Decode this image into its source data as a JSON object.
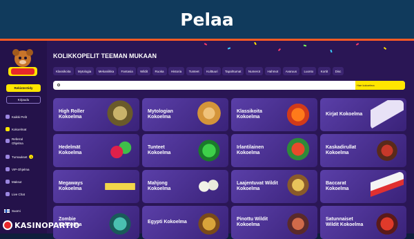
{
  "banner": {
    "title": "Pelaa"
  },
  "sidebar": {
    "register_label": "Rekisteröidy",
    "login_label": "Kirjaudu",
    "nav": [
      {
        "label": "Kaikki Pelit",
        "icon": "grid-icon"
      },
      {
        "label": "Kokoelmat",
        "icon": "collection-icon"
      },
      {
        "label": "Referral Ohjelma",
        "icon": "gift-icon"
      },
      {
        "label": "Turnaukset",
        "icon": "trophy-icon",
        "badge": "1"
      },
      {
        "label": "VIP-Ohjelma",
        "icon": "crown-icon"
      },
      {
        "label": "Maksut",
        "icon": "wallet-icon"
      },
      {
        "label": "Live Chat",
        "icon": "chat-icon"
      }
    ],
    "language": "Suomi"
  },
  "main": {
    "section_title": "KOLIKKOPELIT TEEMAN MUKAAN",
    "themes": [
      "Klassikoita",
      "Mytologia",
      "Mekaniikka",
      "Fantasia",
      "Wildit",
      "Ruoka",
      "Historia",
      "Tunteet",
      "Kulttuuri",
      "Tapahtumat",
      "Numerot",
      "Hahmot",
      "Avaruus",
      "Luonto",
      "Kortit",
      "Disc"
    ],
    "search": {
      "placeholder": "",
      "button": "Hae kokoelma"
    },
    "cards": [
      {
        "label": "High Roller Kokoelma",
        "art": "vault-art"
      },
      {
        "label": "Mytologian Kokoelma",
        "art": "goddess-art"
      },
      {
        "label": "Klassikoita Kokoelma",
        "art": "lucky-seven-art"
      },
      {
        "label": "Kirjat Kokoelma",
        "art": "book-art"
      },
      {
        "label": "Hedelmät Kokoelma",
        "art": "fruit-art"
      },
      {
        "label": "Tunteet Kokoelma",
        "art": "frog-art"
      },
      {
        "label": "Irlantilainen Kokoelma",
        "art": "leprechaun-art"
      },
      {
        "label": "Kaskadirullat Kokoelma",
        "art": "warrior-art"
      },
      {
        "label": "Megaways Kokoelma",
        "art": "megaways-logo-art"
      },
      {
        "label": "Mahjong Kokoelma",
        "art": "mahjong-tiles-art"
      },
      {
        "label": "Laajentuvat Wildit Kokoelma",
        "art": "adventurer-art"
      },
      {
        "label": "Baccarat Kokoelma",
        "art": "cards-art"
      },
      {
        "label": "Zombie Kokoelma",
        "art": "zombie-art"
      },
      {
        "label": "Egypti Kokoelma",
        "art": "pharaoh-art"
      },
      {
        "label": "Pinottu Wildit Kokoelma",
        "art": "heroine-art"
      },
      {
        "label": "Satunnaiset Wildit Kokoelma",
        "art": "demon-art"
      }
    ]
  },
  "footer": {
    "brand": "KASINOPARTIO"
  },
  "colors": {
    "banner": "#103a5c",
    "accent": "#ffe600",
    "divider": "#ff5a24",
    "background": "#2a1655"
  }
}
